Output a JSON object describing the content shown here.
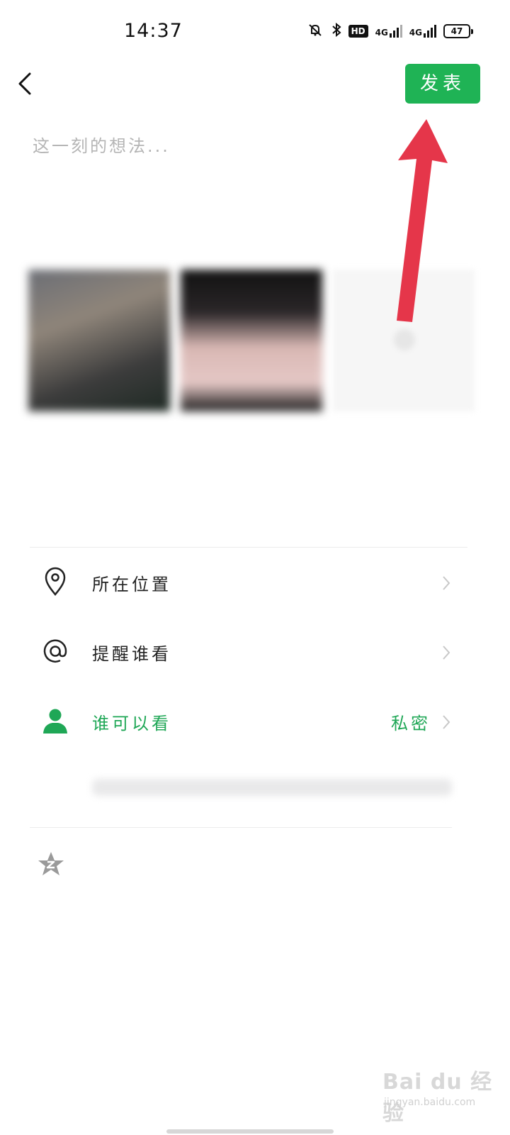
{
  "status_bar": {
    "time": "14:37",
    "net1": "4G",
    "net2": "4G",
    "hd": "HD",
    "battery": "47"
  },
  "header": {
    "publish_label": "发表",
    "back_icon": "chevron-left-icon"
  },
  "compose": {
    "placeholder": "这一刻的想法..."
  },
  "list": {
    "location_label": "所在位置",
    "remind_label": "提醒谁看",
    "visibility_label": "谁可以看",
    "visibility_value": "私密"
  },
  "watermark": {
    "text": "Bai du 经验",
    "sub": "jingyan.baidu.com"
  },
  "colors": {
    "accent": "#1fb355",
    "green_text": "#1fa756",
    "arrow": "#e5364a"
  }
}
